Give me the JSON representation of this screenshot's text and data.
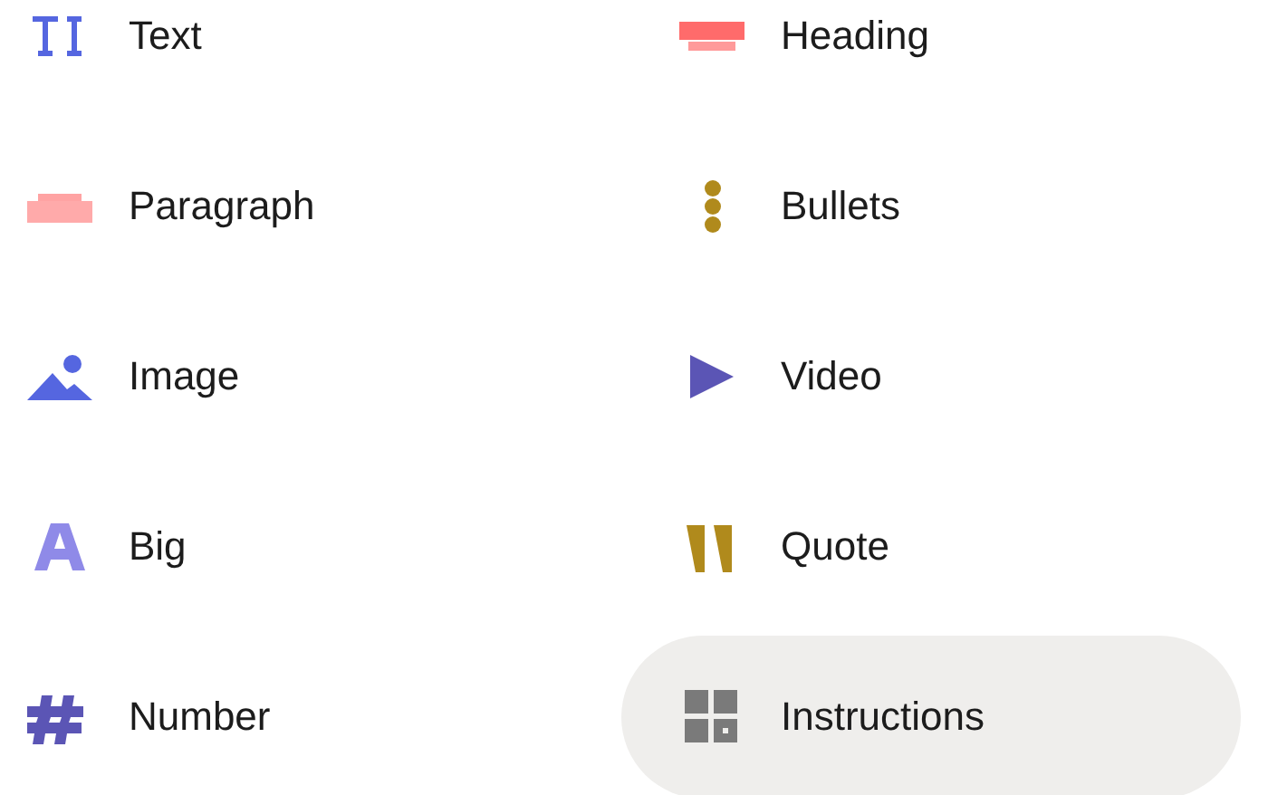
{
  "block_types": [
    {
      "label": "Text",
      "kind": "text",
      "selected": false
    },
    {
      "label": "Heading",
      "kind": "heading",
      "selected": false
    },
    {
      "label": "Paragraph",
      "kind": "paragraph",
      "selected": false
    },
    {
      "label": "Bullets",
      "kind": "bullets",
      "selected": false
    },
    {
      "label": "Image",
      "kind": "image",
      "selected": false
    },
    {
      "label": "Video",
      "kind": "video",
      "selected": false
    },
    {
      "label": "Big",
      "kind": "big",
      "selected": false
    },
    {
      "label": "Quote",
      "kind": "quote",
      "selected": false
    },
    {
      "label": "Number",
      "kind": "number",
      "selected": false
    },
    {
      "label": "Instructions",
      "kind": "instructions",
      "selected": true
    }
  ]
}
